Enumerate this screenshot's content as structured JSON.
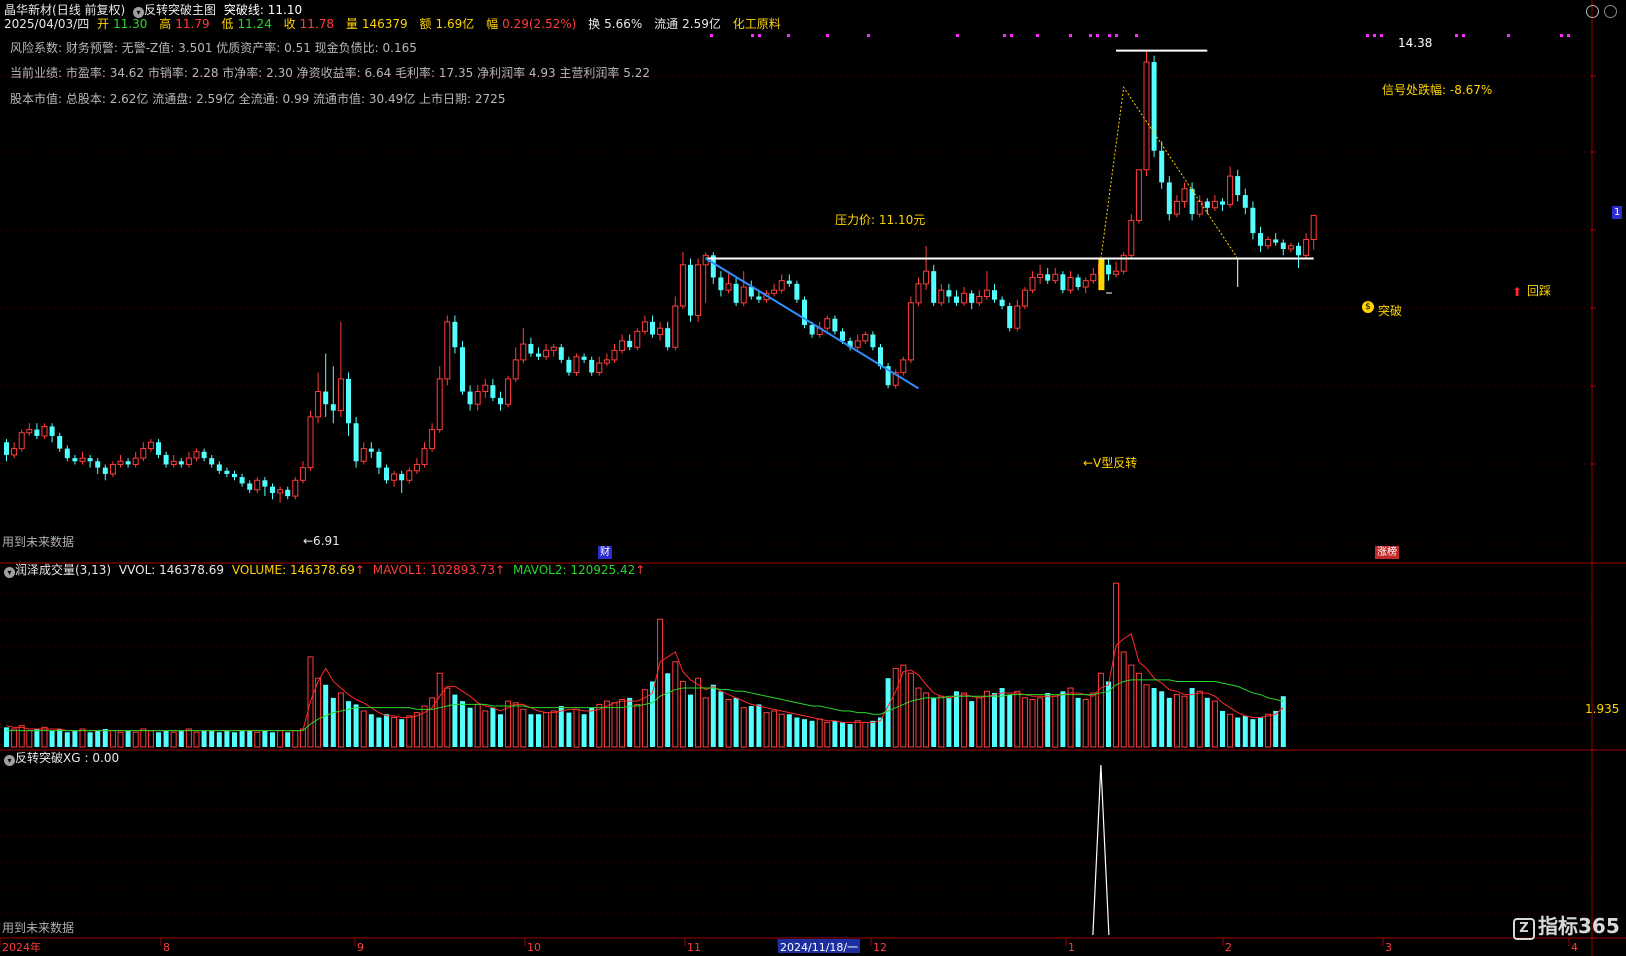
{
  "header": {
    "stock_name": "晶华新材",
    "period": "(日线 前复权)",
    "indicator_name": "反转突破主图",
    "breakline_label": "突破线: 11.10",
    "date": "2025/04/03/四",
    "open": {
      "label": "开",
      "value": "11.30"
    },
    "high": {
      "label": "高",
      "value": "11.79"
    },
    "low": {
      "label": "低",
      "value": "11.24"
    },
    "close": {
      "label": "收",
      "value": "11.78"
    },
    "volume": {
      "label": "量",
      "value": "146379"
    },
    "amount": {
      "label": "额",
      "value": "1.69亿"
    },
    "change": {
      "label": "幅",
      "value": "0.29(2.52%)"
    },
    "turnover": {
      "label": "换",
      "value": "5.66%"
    },
    "float": {
      "label": "流通",
      "value": "2.59亿"
    },
    "sector": "化工原料"
  },
  "info_lines": [
    "风险系数: 财务预警: 无警-Z值: 3.501 优质资产率: 0.51 现金负债比: 0.165",
    "当前业绩: 市盈率: 34.62 市销率: 2.28 市净率: 2.30 净资收益率: 6.64 毛利率: 17.35 净利润率 4.93 主营利润率 5.22",
    "股本市值: 总股本: 2.62亿 流通盘: 2.59亿 全流通: 0.99 流通市值: 30.49亿 上市日期: 2725"
  ],
  "annotations": {
    "pressure_price": "压力价: 11.10元",
    "high_price": "14.38",
    "drop_label": "信号处跌幅: -8.67%",
    "v_reversal": "←V型反转",
    "low_price": "←6.91",
    "breakout": "突破",
    "pullback": "回踩",
    "future_data_main": "用到未来数据",
    "future_data_bottom": "用到未来数据",
    "tag_fin": "财",
    "tag_rank": "涨榜",
    "right_price": "1"
  },
  "volume_panel": {
    "title": "润泽成交量(3,13)",
    "vvol": "VVOL: 146378.69",
    "volume": "VOLUME: 146378.69",
    "mavol1": "MAVOL1: 102893.73",
    "mavol2": "MAVOL2: 120925.42",
    "right_value": "1.935"
  },
  "xg_panel": {
    "title": "反转突破XG",
    "value": ": 0.00"
  },
  "x_axis": {
    "labels": [
      "2024年",
      "8",
      "9",
      "10",
      "11",
      "2024/11/18/一",
      "12",
      "1",
      "2",
      "3",
      "4"
    ]
  },
  "watermark": "指标365",
  "colors": {
    "up": "#ff3d3d",
    "down": "#54ffff",
    "white": "#ffffff",
    "yellow": "#ffd400",
    "ma1": "#ff2a2a",
    "ma2": "#2ad62a",
    "trend": "#2f8fff",
    "magenta": "#ff2aff"
  },
  "chart_data": {
    "type": "candlestick",
    "price_range": [
      6.5,
      14.8
    ],
    "breakline": 11.1,
    "candles": [
      [
        8.2,
        8.0,
        8.25,
        7.9
      ],
      [
        8.0,
        8.1,
        8.2,
        7.95
      ],
      [
        8.1,
        8.35,
        8.4,
        8.05
      ],
      [
        8.35,
        8.4,
        8.5,
        8.3
      ],
      [
        8.4,
        8.3,
        8.5,
        8.25
      ],
      [
        8.3,
        8.45,
        8.5,
        8.25
      ],
      [
        8.45,
        8.3,
        8.5,
        8.2
      ],
      [
        8.3,
        8.1,
        8.35,
        8.05
      ],
      [
        8.1,
        7.95,
        8.15,
        7.9
      ],
      [
        7.95,
        7.9,
        8.0,
        7.85
      ],
      [
        7.9,
        7.95,
        8.05,
        7.85
      ],
      [
        7.95,
        7.9,
        8.0,
        7.8
      ],
      [
        7.9,
        7.8,
        7.95,
        7.7
      ],
      [
        7.8,
        7.7,
        7.85,
        7.6
      ],
      [
        7.7,
        7.85,
        7.9,
        7.65
      ],
      [
        7.85,
        7.9,
        8.0,
        7.8
      ],
      [
        7.9,
        7.85,
        7.95,
        7.8
      ],
      [
        7.85,
        7.95,
        8.05,
        7.8
      ],
      [
        7.95,
        8.1,
        8.2,
        7.9
      ],
      [
        8.1,
        8.2,
        8.25,
        8.05
      ],
      [
        8.2,
        8.0,
        8.25,
        7.95
      ],
      [
        8.0,
        7.85,
        8.05,
        7.8
      ],
      [
        7.85,
        7.9,
        8.0,
        7.8
      ],
      [
        7.9,
        7.85,
        7.95,
        7.8
      ],
      [
        7.85,
        7.95,
        8.05,
        7.8
      ],
      [
        7.95,
        8.05,
        8.1,
        7.9
      ],
      [
        8.05,
        7.95,
        8.1,
        7.9
      ],
      [
        7.95,
        7.85,
        8.0,
        7.8
      ],
      [
        7.85,
        7.75,
        7.9,
        7.7
      ],
      [
        7.75,
        7.7,
        7.8,
        7.65
      ],
      [
        7.7,
        7.65,
        7.75,
        7.6
      ],
      [
        7.65,
        7.55,
        7.7,
        7.5
      ],
      [
        7.55,
        7.45,
        7.6,
        7.4
      ],
      [
        7.45,
        7.6,
        7.65,
        7.4
      ],
      [
        7.6,
        7.5,
        7.65,
        7.35
      ],
      [
        7.5,
        7.4,
        7.55,
        7.3
      ],
      [
        7.4,
        7.45,
        7.5,
        7.25
      ],
      [
        7.45,
        7.35,
        7.5,
        7.3
      ],
      [
        7.35,
        7.6,
        7.65,
        7.3
      ],
      [
        7.6,
        7.8,
        7.9,
        7.55
      ],
      [
        7.8,
        8.6,
        8.7,
        7.75
      ],
      [
        8.6,
        9.0,
        9.3,
        8.5
      ],
      [
        9.0,
        8.8,
        9.6,
        8.6
      ],
      [
        8.8,
        8.7,
        9.4,
        8.5
      ],
      [
        8.7,
        9.2,
        10.1,
        8.6
      ],
      [
        9.2,
        8.5,
        9.3,
        8.3
      ],
      [
        8.5,
        7.9,
        8.6,
        7.8
      ],
      [
        7.9,
        8.1,
        8.2,
        7.85
      ],
      [
        8.1,
        8.05,
        8.2,
        7.95
      ],
      [
        8.05,
        7.8,
        8.1,
        7.7
      ],
      [
        7.8,
        7.6,
        7.85,
        7.55
      ],
      [
        7.6,
        7.7,
        7.75,
        7.5
      ],
      [
        7.7,
        7.6,
        7.75,
        7.4
      ],
      [
        7.6,
        7.75,
        7.8,
        7.55
      ],
      [
        7.75,
        7.85,
        7.95,
        7.7
      ],
      [
        7.85,
        8.1,
        8.2,
        7.8
      ],
      [
        8.1,
        8.4,
        8.5,
        8.05
      ],
      [
        8.4,
        9.2,
        9.4,
        8.35
      ],
      [
        9.2,
        10.1,
        10.2,
        9.1
      ],
      [
        10.1,
        9.7,
        10.2,
        9.6
      ],
      [
        9.7,
        9.0,
        9.8,
        8.95
      ],
      [
        9.0,
        8.8,
        9.1,
        8.7
      ],
      [
        8.8,
        9.0,
        9.1,
        8.7
      ],
      [
        9.0,
        9.1,
        9.2,
        8.9
      ],
      [
        9.1,
        8.9,
        9.2,
        8.85
      ],
      [
        8.9,
        8.8,
        9.0,
        8.7
      ],
      [
        8.8,
        9.2,
        9.25,
        8.75
      ],
      [
        9.2,
        9.5,
        9.7,
        9.15
      ],
      [
        9.5,
        9.75,
        10.0,
        9.45
      ],
      [
        9.75,
        9.6,
        9.85,
        9.55
      ],
      [
        9.6,
        9.55,
        9.7,
        9.5
      ],
      [
        9.55,
        9.65,
        9.75,
        9.5
      ],
      [
        9.65,
        9.7,
        9.75,
        9.55
      ],
      [
        9.7,
        9.5,
        9.75,
        9.45
      ],
      [
        9.5,
        9.3,
        9.55,
        9.25
      ],
      [
        9.3,
        9.55,
        9.6,
        9.25
      ],
      [
        9.55,
        9.5,
        9.6,
        9.45
      ],
      [
        9.5,
        9.3,
        9.55,
        9.25
      ],
      [
        9.3,
        9.45,
        9.55,
        9.25
      ],
      [
        9.45,
        9.5,
        9.6,
        9.4
      ],
      [
        9.5,
        9.65,
        9.75,
        9.45
      ],
      [
        9.65,
        9.8,
        9.9,
        9.6
      ],
      [
        9.8,
        9.7,
        9.9,
        9.65
      ],
      [
        9.7,
        9.95,
        10.0,
        9.65
      ],
      [
        9.95,
        10.1,
        10.2,
        9.9
      ],
      [
        10.1,
        9.9,
        10.2,
        9.85
      ],
      [
        9.9,
        10.0,
        10.1,
        9.8
      ],
      [
        10.0,
        9.7,
        10.1,
        9.65
      ],
      [
        9.7,
        10.35,
        10.5,
        9.65
      ],
      [
        10.35,
        11.0,
        11.2,
        10.3
      ],
      [
        11.0,
        10.2,
        11.1,
        10.1
      ],
      [
        10.2,
        11.0,
        11.1,
        10.1
      ],
      [
        11.0,
        11.15,
        11.2,
        10.4
      ],
      [
        11.15,
        10.8,
        11.2,
        10.7
      ],
      [
        10.8,
        10.6,
        10.9,
        10.5
      ],
      [
        10.6,
        10.7,
        10.9,
        10.55
      ],
      [
        10.7,
        10.4,
        10.8,
        10.35
      ],
      [
        10.4,
        10.65,
        10.9,
        10.35
      ],
      [
        10.65,
        10.5,
        10.75,
        10.45
      ],
      [
        10.5,
        10.45,
        10.6,
        10.4
      ],
      [
        10.45,
        10.55,
        10.6,
        10.4
      ],
      [
        10.55,
        10.6,
        10.7,
        10.5
      ],
      [
        10.6,
        10.75,
        10.85,
        10.55
      ],
      [
        10.75,
        10.7,
        10.85,
        10.65
      ],
      [
        10.7,
        10.45,
        10.75,
        10.4
      ],
      [
        10.45,
        10.05,
        10.5,
        10.0
      ],
      [
        10.05,
        9.9,
        10.1,
        9.85
      ],
      [
        9.9,
        10.0,
        10.1,
        9.85
      ],
      [
        10.0,
        10.15,
        10.2,
        9.95
      ],
      [
        10.15,
        9.95,
        10.2,
        9.9
      ],
      [
        9.95,
        9.8,
        10.0,
        9.75
      ],
      [
        9.8,
        9.7,
        9.85,
        9.65
      ],
      [
        9.7,
        9.8,
        9.9,
        9.65
      ],
      [
        9.8,
        9.9,
        9.95,
        9.75
      ],
      [
        9.9,
        9.7,
        9.95,
        9.65
      ],
      [
        9.7,
        9.4,
        9.75,
        9.35
      ],
      [
        9.4,
        9.1,
        9.45,
        9.05
      ],
      [
        9.1,
        9.3,
        9.35,
        9.05
      ],
      [
        9.3,
        9.5,
        9.55,
        9.25
      ],
      [
        9.5,
        10.4,
        10.5,
        9.45
      ],
      [
        10.4,
        10.7,
        10.8,
        10.35
      ],
      [
        10.7,
        10.9,
        11.3,
        10.6
      ],
      [
        10.9,
        10.4,
        11.0,
        10.35
      ],
      [
        10.4,
        10.6,
        10.7,
        10.35
      ],
      [
        10.6,
        10.5,
        10.7,
        10.4
      ],
      [
        10.5,
        10.4,
        10.6,
        10.35
      ],
      [
        10.4,
        10.55,
        10.65,
        10.35
      ],
      [
        10.55,
        10.4,
        10.6,
        10.3
      ],
      [
        10.4,
        10.5,
        10.6,
        10.35
      ],
      [
        10.5,
        10.6,
        10.9,
        10.45
      ],
      [
        10.6,
        10.45,
        10.7,
        10.4
      ],
      [
        10.45,
        10.35,
        10.5,
        10.3
      ],
      [
        10.35,
        10.0,
        10.4,
        9.95
      ],
      [
        10.0,
        10.35,
        10.45,
        9.95
      ],
      [
        10.35,
        10.6,
        10.65,
        10.3
      ],
      [
        10.6,
        10.8,
        10.9,
        10.55
      ],
      [
        10.8,
        10.85,
        11.0,
        10.7
      ],
      [
        10.85,
        10.75,
        10.95,
        10.7
      ],
      [
        10.75,
        10.85,
        10.95,
        10.7
      ],
      [
        10.85,
        10.6,
        10.9,
        10.55
      ],
      [
        10.6,
        10.8,
        10.9,
        10.55
      ],
      [
        10.8,
        10.65,
        10.85,
        10.6
      ],
      [
        10.65,
        10.75,
        10.8,
        10.55
      ],
      [
        10.75,
        10.85,
        10.95,
        10.7
      ],
      [
        10.85,
        11.0,
        11.1,
        10.8
      ],
      [
        11.0,
        10.85,
        11.1,
        10.75
      ],
      [
        10.85,
        10.9,
        11.05,
        10.8
      ],
      [
        10.9,
        11.15,
        11.2,
        10.85
      ],
      [
        11.15,
        11.7,
        11.8,
        11.1
      ],
      [
        11.7,
        12.5,
        12.5,
        11.65
      ],
      [
        12.5,
        14.2,
        14.38,
        12.4
      ],
      [
        14.2,
        12.8,
        14.3,
        12.7
      ],
      [
        12.8,
        12.3,
        12.95,
        12.2
      ],
      [
        12.3,
        11.8,
        12.4,
        11.7
      ],
      [
        11.8,
        12.0,
        12.1,
        11.75
      ],
      [
        12.0,
        12.2,
        12.3,
        11.9
      ],
      [
        12.2,
        11.8,
        12.3,
        11.7
      ],
      [
        11.8,
        12.0,
        12.1,
        11.75
      ],
      [
        12.0,
        11.9,
        12.05,
        11.8
      ],
      [
        11.9,
        12.0,
        12.1,
        11.85
      ],
      [
        12.0,
        11.95,
        12.05,
        11.85
      ],
      [
        11.95,
        12.4,
        12.55,
        11.9
      ],
      [
        12.4,
        12.1,
        12.5,
        12.0
      ],
      [
        12.1,
        11.9,
        12.2,
        11.8
      ],
      [
        11.9,
        11.5,
        12.0,
        11.4
      ],
      [
        11.5,
        11.3,
        11.6,
        11.2
      ],
      [
        11.3,
        11.4,
        11.45,
        11.25
      ],
      [
        11.4,
        11.35,
        11.5,
        11.3
      ],
      [
        11.35,
        11.25,
        11.4,
        11.15
      ],
      [
        11.25,
        11.3,
        11.35,
        11.2
      ],
      [
        11.3,
        11.15,
        11.35,
        10.95
      ],
      [
        11.15,
        11.4,
        11.5,
        11.1
      ],
      [
        11.4,
        11.78,
        11.79,
        11.24
      ]
    ],
    "volumes": [
      12,
      11,
      13,
      10,
      11,
      12,
      10,
      11,
      9,
      10,
      11,
      9,
      10,
      11,
      10,
      9,
      10,
      9,
      11,
      10,
      9,
      10,
      9,
      10,
      11,
      9,
      10,
      10,
      9,
      10,
      9,
      10,
      10,
      9,
      10,
      9,
      10,
      9,
      10,
      11,
      55,
      42,
      38,
      30,
      33,
      28,
      26,
      22,
      20,
      18,
      20,
      18,
      17,
      19,
      21,
      25,
      30,
      45,
      36,
      32,
      28,
      24,
      26,
      22,
      24,
      20,
      28,
      27,
      23,
      20,
      20,
      21,
      22,
      25,
      21,
      23,
      20,
      24,
      26,
      28,
      27,
      29,
      30,
      26,
      35,
      40,
      78,
      45,
      52,
      40,
      32,
      42,
      30,
      38,
      34,
      29,
      30,
      24,
      25,
      26,
      21,
      22,
      20,
      20,
      18,
      17,
      16,
      17,
      15,
      16,
      15,
      14,
      16,
      15,
      16,
      18,
      42,
      48,
      50,
      45,
      36,
      33,
      30,
      31,
      30,
      34,
      33,
      28,
      30,
      34,
      33,
      36,
      32,
      34,
      30,
      29,
      30,
      33,
      31,
      34,
      36,
      30,
      29,
      33,
      45,
      40,
      100,
      58,
      50,
      45,
      38,
      36,
      34,
      30,
      32,
      31,
      36,
      34,
      30,
      28,
      22,
      20,
      18,
      19,
      17,
      18,
      20,
      22,
      31
    ],
    "mavol1": [
      13,
      12,
      12,
      11,
      11,
      11,
      11,
      11,
      10,
      10,
      10,
      10,
      10,
      10,
      10,
      10,
      10,
      10,
      10,
      10,
      10,
      10,
      10,
      10,
      10,
      10,
      10,
      10,
      10,
      10,
      10,
      10,
      10,
      10,
      10,
      10,
      10,
      10,
      10,
      10,
      28,
      40,
      48,
      40,
      36,
      32,
      29,
      27,
      24,
      21,
      19,
      19,
      18,
      18,
      19,
      21,
      24,
      31,
      37,
      37,
      34,
      31,
      27,
      25,
      24,
      22,
      24,
      26,
      26,
      24,
      22,
      21,
      21,
      22,
      23,
      23,
      22,
      22,
      23,
      25,
      27,
      28,
      28,
      28,
      30,
      33,
      52,
      55,
      58,
      46,
      41,
      38,
      35,
      37,
      34,
      32,
      30,
      28,
      26,
      25,
      24,
      23,
      22,
      21,
      20,
      19,
      18,
      17,
      16,
      16,
      15,
      15,
      15,
      15,
      15,
      16,
      25,
      34,
      46,
      47,
      44,
      38,
      33,
      31,
      30,
      31,
      32,
      31,
      30,
      31,
      32,
      33,
      33,
      33,
      32,
      31,
      31,
      31,
      31,
      32,
      33,
      33,
      32,
      31,
      36,
      38,
      62,
      66,
      69,
      52,
      48,
      42,
      39,
      35,
      34,
      32,
      32,
      33,
      33,
      31,
      27,
      24,
      21,
      19,
      18,
      18,
      19,
      20,
      24
    ],
    "mavol2": [
      10,
      10,
      10,
      10,
      10,
      10,
      10,
      10,
      10,
      10,
      10,
      10,
      10,
      10,
      10,
      10,
      10,
      10,
      10,
      10,
      10,
      10,
      10,
      10,
      10,
      10,
      10,
      10,
      10,
      10,
      10,
      10,
      10,
      10,
      10,
      10,
      10,
      10,
      10,
      10,
      14,
      17,
      19,
      21,
      22,
      23,
      24,
      24,
      24,
      24,
      24,
      24,
      24,
      24,
      23,
      23,
      23,
      24,
      25,
      26,
      26,
      26,
      26,
      26,
      25,
      25,
      25,
      25,
      25,
      24,
      24,
      24,
      24,
      24,
      24,
      24,
      24,
      24,
      24,
      24,
      24,
      24,
      25,
      25,
      26,
      27,
      31,
      33,
      35,
      36,
      36,
      36,
      36,
      36,
      35,
      35,
      34,
      34,
      33,
      32,
      31,
      30,
      29,
      28,
      27,
      26,
      25,
      25,
      24,
      23,
      22,
      22,
      21,
      21,
      20,
      20,
      22,
      24,
      26,
      28,
      29,
      30,
      30,
      30,
      31,
      31,
      31,
      31,
      31,
      31,
      31,
      31,
      32,
      32,
      32,
      32,
      32,
      32,
      32,
      32,
      32,
      32,
      32,
      32,
      33,
      34,
      38,
      40,
      41,
      41,
      41,
      41,
      41,
      41,
      40,
      40,
      40,
      40,
      40,
      40,
      39,
      38,
      37,
      35,
      33,
      32,
      30,
      29,
      28
    ],
    "xg_signal_index": 145
  }
}
